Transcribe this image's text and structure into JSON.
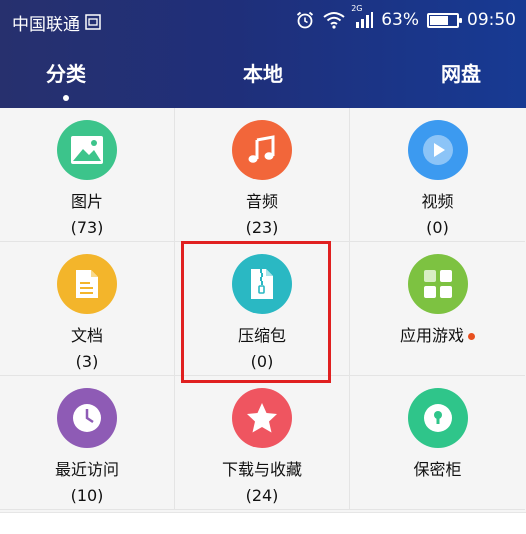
{
  "status_bar": {
    "carrier": "中国联通",
    "network": "2G",
    "battery_percent": "63%",
    "battery_level": 0.63,
    "time": "09:50"
  },
  "tabs": [
    {
      "label": "分类",
      "selected": true
    },
    {
      "label": "本地",
      "selected": false
    },
    {
      "label": "网盘",
      "selected": false
    }
  ],
  "categories": [
    {
      "label": "图片",
      "count": "(73)",
      "icon": "image-icon",
      "color": "#3cc48b"
    },
    {
      "label": "音频",
      "count": "(23)",
      "icon": "music-icon",
      "color": "#f2663a"
    },
    {
      "label": "视频",
      "count": "(0)",
      "icon": "play-icon",
      "color": "#3c9af0"
    },
    {
      "label": "文档",
      "count": "(3)",
      "icon": "document-icon",
      "color": "#f3b52b"
    },
    {
      "label": "压缩包",
      "count": "(0)",
      "icon": "zip-icon",
      "color": "#2ab8c3"
    },
    {
      "label": "应用游戏",
      "count": "",
      "icon": "apps-icon",
      "color": "#7dc241",
      "badge": true
    },
    {
      "label": "最近访问",
      "count": "(10)",
      "icon": "clock-icon",
      "color": "#8e5bb5"
    },
    {
      "label": "下载与收藏",
      "count": "(24)",
      "icon": "star-icon",
      "color": "#ef5560"
    },
    {
      "label": "保密柜",
      "count": "",
      "icon": "lock-icon",
      "color": "#2fc58a"
    }
  ],
  "colors": {
    "header_start": "#27306e",
    "header_end": "#173a93",
    "highlight_border": "#e02020",
    "badge": "#e8501f"
  }
}
